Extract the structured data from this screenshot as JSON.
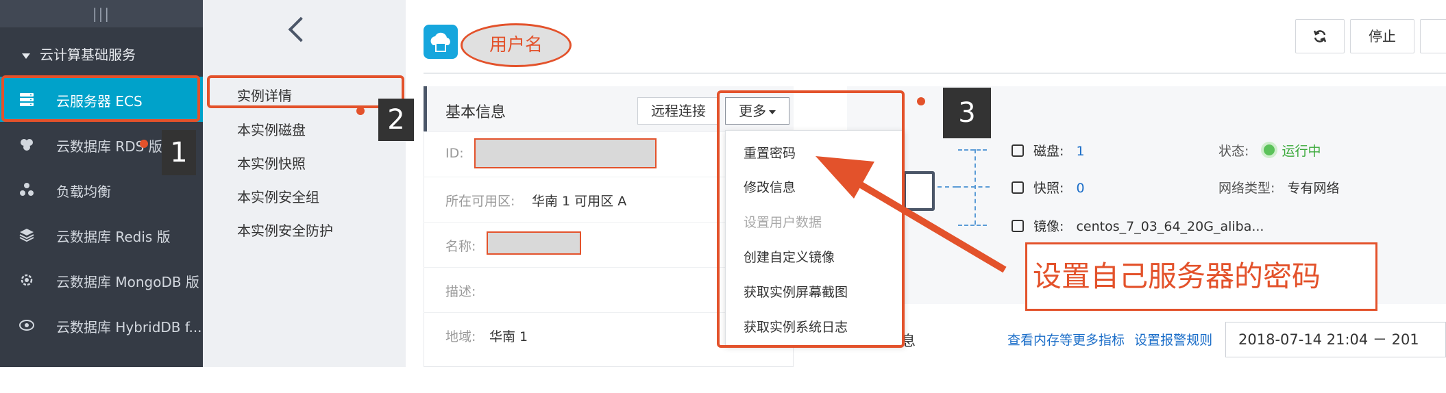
{
  "sidebar": {
    "grip": "|||",
    "group": "云计算基础服务",
    "items": [
      {
        "label": "云服务器 ECS",
        "icon": "server-icon"
      },
      {
        "label": "云数据库 RDS 版",
        "icon": "database-cluster-icon"
      },
      {
        "label": "负载均衡",
        "icon": "load-balancer-icon"
      },
      {
        "label": "云数据库 Redis 版",
        "icon": "layers-icon"
      },
      {
        "label": "云数据库 MongoDB 版",
        "icon": "gear-database-icon"
      },
      {
        "label": "云数据库 HybridDB f...",
        "icon": "eye-database-icon"
      }
    ]
  },
  "subpanel": {
    "items": [
      "实例详情",
      "本实例磁盘",
      "本实例快照",
      "本实例安全组",
      "本实例安全防护"
    ]
  },
  "header": {
    "username": "用户名",
    "refresh_icon": "refresh-icon",
    "stop_label": "停止"
  },
  "basic_info": {
    "title": "基本信息",
    "remote_label": "远程连接",
    "more_label": "更多",
    "rows": [
      {
        "key": "ID:",
        "value": ""
      },
      {
        "key": "所在可用区:",
        "value": "华南 1 可用区 A"
      },
      {
        "key": "名称:",
        "value": ""
      },
      {
        "key": "描述:",
        "value": ""
      },
      {
        "key": "地域:",
        "value": "华南 1"
      }
    ]
  },
  "more_menu": [
    {
      "label": "重置密码",
      "enabled": true
    },
    {
      "label": "修改信息",
      "enabled": true
    },
    {
      "label": "设置用户数据",
      "enabled": false
    },
    {
      "label": "创建自定义镜像",
      "enabled": true
    },
    {
      "label": "获取实例屏幕截图",
      "enabled": true
    },
    {
      "label": "获取实例系统日志",
      "enabled": true
    }
  ],
  "resources": {
    "disk_label": "磁盘:",
    "disk_value": "1",
    "snapshot_label": "快照:",
    "snapshot_value": "0",
    "image_label": "镜像:",
    "image_value": "centos_7_03_64_20G_aliba...",
    "status_label": "状态:",
    "status_value": "运行中",
    "network_label": "网络类型:",
    "network_value": "专有网络"
  },
  "monitor": {
    "title": "监控信息",
    "link1": "查看内存等更多指标",
    "link2": "设置报警规则",
    "date_range": "2018-07-14 21:04  －  201"
  },
  "annotations": {
    "badge1": "1",
    "badge2": "2",
    "badge3": "3",
    "callout": "设置自己服务器的密码"
  },
  "colors": {
    "sidebar_bg": "#353b45",
    "active_bg": "#00a2ca",
    "annotation_red": "#e3522b",
    "link_blue": "#1a6dc8"
  }
}
